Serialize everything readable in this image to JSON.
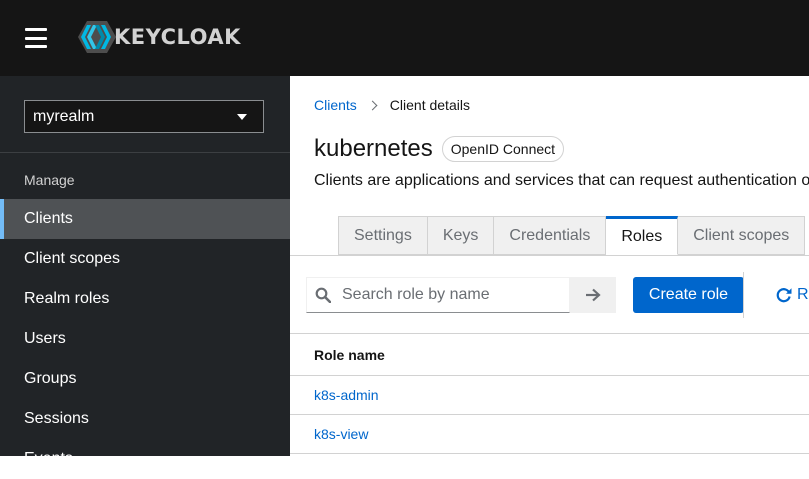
{
  "header": {
    "brand": "KEYCLOAK",
    "menu_icon": "hamburger-icon",
    "logo_icon": "keycloak-logo-icon"
  },
  "sidebar": {
    "realm": "myrealm",
    "section": "Manage",
    "items": [
      {
        "label": "Clients",
        "active": true
      },
      {
        "label": "Client scopes"
      },
      {
        "label": "Realm roles"
      },
      {
        "label": "Users"
      },
      {
        "label": "Groups"
      },
      {
        "label": "Sessions"
      },
      {
        "label": "Events"
      }
    ]
  },
  "breadcrumb": {
    "link": "Clients",
    "current": "Client details"
  },
  "page": {
    "title": "kubernetes",
    "badge": "OpenID Connect",
    "description": "Clients are applications and services that can request authentication of a user."
  },
  "tabs": [
    "Settings",
    "Keys",
    "Credentials",
    "Roles",
    "Client scopes"
  ],
  "active_tab": "Roles",
  "toolbar": {
    "search_placeholder": "Search role by name",
    "create_label": "Create role",
    "refresh_label": "Refresh"
  },
  "table": {
    "header": "Role name",
    "rows": [
      "k8s-admin",
      "k8s-view"
    ]
  },
  "colors": {
    "masthead": "#151515",
    "sidebar": "#212427",
    "accent": "#0066cc",
    "active_indicator": "#73bcf7"
  }
}
